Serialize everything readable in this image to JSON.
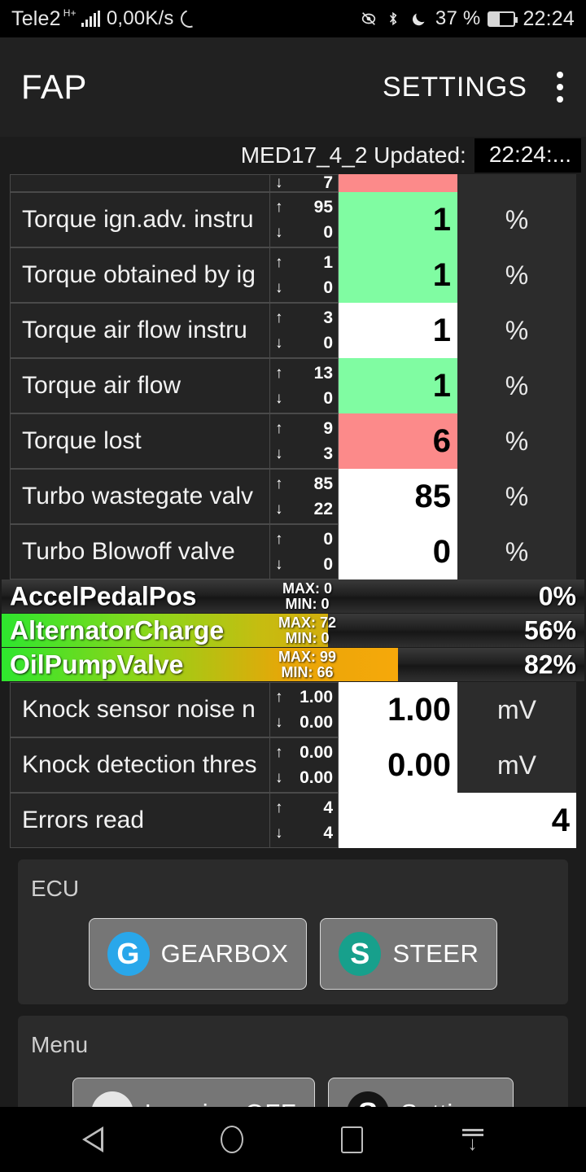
{
  "status_bar": {
    "carrier": "Tele2",
    "network_type": "H+",
    "data_speed": "0,00K/s",
    "battery_percent": "37 %",
    "clock": "22:24",
    "icons": [
      "sync-icon",
      "eye-off-icon",
      "bluetooth-icon",
      "do-not-disturb-moon-icon",
      "battery-icon"
    ]
  },
  "app_bar": {
    "title": "FAP",
    "settings_label": "SETTINGS",
    "overflow": "overflow-menu-icon"
  },
  "update_header": {
    "label": "MED17_4_2 Updated:",
    "time": "22:24:..."
  },
  "table": {
    "clipped_top_row": {
      "min": "7",
      "value_color": "red"
    },
    "rows": [
      {
        "label": "Torque ign.adv. instru",
        "max": "95",
        "min": "0",
        "value": "1",
        "unit": "%",
        "state": "green"
      },
      {
        "label": "Torque obtained by ig",
        "max": "1",
        "min": "0",
        "value": "1",
        "unit": "%",
        "state": "green"
      },
      {
        "label": "Torque air flow instru",
        "max": "3",
        "min": "0",
        "value": "1",
        "unit": "%",
        "state": "white"
      },
      {
        "label": "Torque air flow",
        "max": "13",
        "min": "0",
        "value": "1",
        "unit": "%",
        "state": "green"
      },
      {
        "label": "Torque lost",
        "max": "9",
        "min": "3",
        "value": "6",
        "unit": "%",
        "state": "red"
      },
      {
        "label": "Turbo wastegate valv",
        "max": "85",
        "min": "22",
        "value": "85",
        "unit": "%",
        "state": "white"
      },
      {
        "label": "Turbo Blowoff valve",
        "max": "0",
        "min": "0",
        "value": "0",
        "unit": "%",
        "state": "white"
      }
    ],
    "rows_after_gauges": [
      {
        "label": "Knock sensor noise n",
        "max": "1.00",
        "min": "0.00",
        "value": "1.00",
        "unit": "mV",
        "state": "white"
      },
      {
        "label": "Knock detection thres",
        "max": "0.00",
        "min": "0.00",
        "value": "0.00",
        "unit": "mV",
        "state": "white"
      },
      {
        "label": "Errors read",
        "max": "4",
        "min": "4",
        "value": "4",
        "unit": "",
        "state": "white",
        "wide": true
      }
    ]
  },
  "gauges": [
    {
      "name": "AccelPedalPos",
      "max_label": "MAX: 0",
      "min_label": "MIN: 0",
      "value_label": "0%",
      "fill_percent": 0
    },
    {
      "name": "AlternatorCharge",
      "max_label": "MAX: 72",
      "min_label": "MIN: 0",
      "value_label": "56%",
      "fill_percent": 56
    },
    {
      "name": "OilPumpValve",
      "max_label": "MAX: 99",
      "min_label": "MIN: 66",
      "value_label": "82%",
      "fill_percent": 68
    }
  ],
  "ecu_card": {
    "title": "ECU",
    "buttons": [
      {
        "badge": "G",
        "label": "GEARBOX",
        "badge_color": "#29a7ea"
      },
      {
        "badge": "S",
        "label": "STEER",
        "badge_color": "#17a08c"
      }
    ]
  },
  "menu_card": {
    "title": "Menu",
    "buttons": [
      {
        "badge": "",
        "label": "Logging OFF",
        "badge_color": "#e6e6e6"
      },
      {
        "badge": "S",
        "label": "Settings",
        "badge_color": "#151515"
      }
    ]
  },
  "nav_bar": {
    "items": [
      "back-icon",
      "home-icon",
      "recents-icon",
      "hide-nav-icon"
    ]
  },
  "colors": {
    "value_green": "#80fca2",
    "value_red": "#fc8a8a",
    "accent_blue": "#29a7ea",
    "accent_teal": "#17a08c"
  }
}
